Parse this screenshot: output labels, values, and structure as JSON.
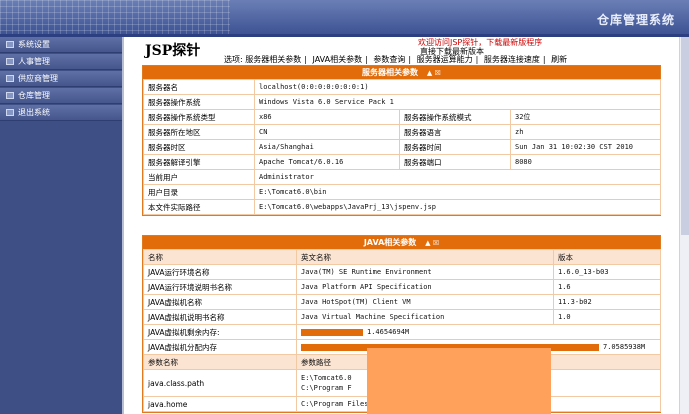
{
  "window": {
    "title": "仓库管理系统"
  },
  "sidebar": {
    "items": [
      {
        "label": "系统设置"
      },
      {
        "label": "人事管理"
      },
      {
        "label": "供应商管理"
      },
      {
        "label": "仓库管理"
      },
      {
        "label": "退出系统"
      }
    ]
  },
  "main": {
    "page_title": "JSP探针",
    "notice_line1": "欢迎访问JSP探针，下载最新版程序",
    "notice_line2": "直接下载最新版本",
    "options_label": "选项:",
    "options": [
      "服务器相关参数",
      "JAVA相关参数",
      "参数查询",
      "服务器运算能力",
      "服务器连接速度",
      "刷新"
    ]
  },
  "server_section": {
    "title": "服务器相关参数",
    "rows": [
      {
        "k1": "服务器名",
        "v1": "localhost(0:0:0:0:0:0:0:1)"
      },
      {
        "k1": "服务器操作系统",
        "v1": "Windows Vista 6.0 Service Pack 1"
      },
      {
        "k1": "服务器操作系统类型",
        "v1": "x86",
        "k2": "服务器操作系统模式",
        "v2": "32位"
      },
      {
        "k1": "服务器所在地区",
        "v1": "CN",
        "k2": "服务器语言",
        "v2": "zh"
      },
      {
        "k1": "服务器时区",
        "v1": "Asia/Shanghai",
        "k2": "服务器时间",
        "v2": "Sun Jan 31 10:02:30 CST 2010"
      },
      {
        "k1": "服务器解译引擎",
        "v1": "Apache Tomcat/6.0.16",
        "k2": "服务器端口",
        "v2": "8080"
      },
      {
        "k1": "当前用户",
        "v1": "Administrator"
      },
      {
        "k1": "用户目录",
        "v1": "E:\\Tomcat6.0\\bin"
      },
      {
        "k1": "本文件实际路径",
        "v1": "E:\\Tomcat6.0\\webapps\\JavaPrj_13\\jspenv.jsp"
      }
    ]
  },
  "java_section": {
    "title": "JAVA相关参数",
    "header": {
      "c1": "名称",
      "c2": "英文名称",
      "c3": "版本"
    },
    "rows": [
      {
        "c1": "JAVA运行环境名称",
        "c2": "Java(TM) SE Runtime Environment",
        "c3": "1.6.0_13-b03"
      },
      {
        "c1": "JAVA运行环境说明书名称",
        "c2": "Java Platform API Specification",
        "c3": "1.6"
      },
      {
        "c1": "JAVA虚拟机名称",
        "c2": "Java HotSpot(TM) Client VM",
        "c3": "11.3-b02"
      },
      {
        "c1": "JAVA虚拟机说明书名称",
        "c2": "Java Virtual Machine Specification",
        "c3": "1.0"
      }
    ],
    "memory": {
      "free_label": "JAVA虚拟机剩余内存:",
      "free_value": "1.4654694M",
      "alloc_label": "JAVA虚拟机分配内存",
      "alloc_value": "7.0585938M"
    },
    "param_header": {
      "c1": "参数名称",
      "c2": "参数路径"
    },
    "params": [
      {
        "name": "java.class.path",
        "path1": "E:\\Tomcat6.0",
        "path2": "C:\\Program F"
      },
      {
        "name": "java.home",
        "path1": "C:\\Program Files\\Java\\jre6"
      }
    ]
  },
  "colors": {
    "accent": "#e36c0a",
    "sidebar": "#45568d",
    "banner": "#3d5393"
  }
}
